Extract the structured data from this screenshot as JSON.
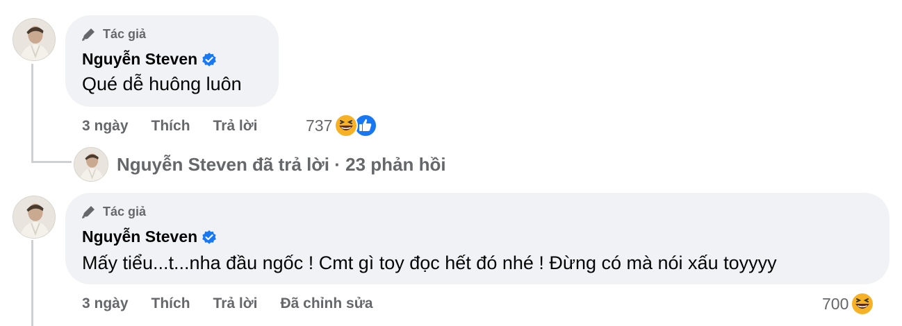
{
  "comments": [
    {
      "author_badge": "Tác giả",
      "author_name": "Nguyễn Steven",
      "text": "Qué dễ huông luôn",
      "time": "3 ngày",
      "like_label": "Thích",
      "reply_label": "Trả lời",
      "edited_label": "",
      "reaction_count": "737",
      "reactions": [
        "haha-icon",
        "like-icon"
      ]
    },
    {
      "author_badge": "Tác giả",
      "author_name": "Nguyễn Steven",
      "text": "Mấy tiểu...t...nha đầu ngốc ! Cmt gì toy đọc hết đó nhé ! Đừng có mà nói xấu toyyyy",
      "time": "3 ngày",
      "like_label": "Thích",
      "reply_label": "Trả lời",
      "edited_label": "Đã chỉnh sửa",
      "reaction_count": "700",
      "reactions": [
        "haha-icon"
      ]
    }
  ],
  "reply_summary": {
    "text": "Nguyễn Steven đã trả lời · 23 phản hồi"
  },
  "colors": {
    "bubble": "#f0f2f5",
    "secondary_text": "#65676b",
    "verified": "#1877f2",
    "like": "#1877f2",
    "haha": "#f7b125",
    "thread_line": "#ced0d4"
  }
}
